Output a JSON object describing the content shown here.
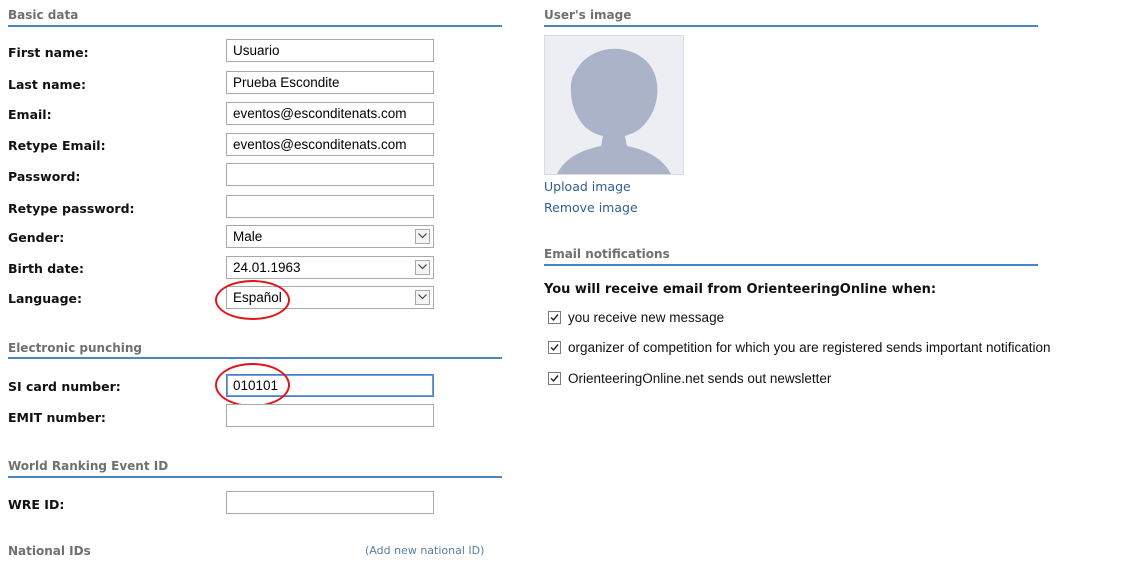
{
  "basic_data": {
    "title": "Basic data",
    "fields": [
      {
        "label": "First name:",
        "value": "Usuario",
        "type": "text"
      },
      {
        "label": "Last name:",
        "value": "Prueba Escondite",
        "type": "text"
      },
      {
        "label": "Email:",
        "value": "eventos@esconditenats.com",
        "type": "text"
      },
      {
        "label": "Retype Email:",
        "value": "eventos@esconditenats.com",
        "type": "text"
      },
      {
        "label": "Password:",
        "value": "",
        "type": "password"
      },
      {
        "label": "Retype password:",
        "value": "",
        "type": "password"
      },
      {
        "label": "Gender:",
        "value": "Male",
        "type": "select"
      },
      {
        "label": "Birth date:",
        "value": "24.01.1963",
        "type": "select"
      },
      {
        "label": "Language:",
        "value": "Español",
        "type": "select"
      }
    ]
  },
  "electronic_punching": {
    "title": "Electronic punching",
    "fields": [
      {
        "label": "SI card number:",
        "value": "010101"
      },
      {
        "label": "EMIT number:",
        "value": ""
      }
    ]
  },
  "world_ranking": {
    "title": "World Ranking Event ID",
    "fields": [
      {
        "label": "WRE ID:",
        "value": ""
      }
    ]
  },
  "national_ids": {
    "title": "National IDs",
    "add_link": "(Add new national ID)"
  },
  "user_image": {
    "title": "User's image",
    "upload_link": "Upload image",
    "remove_link": "Remove image"
  },
  "email_notifications": {
    "title": "Email notifications",
    "heading": "You will receive email from OrienteeringOnline when:",
    "options": [
      {
        "label": "you receive new message",
        "checked": true
      },
      {
        "label": "organizer of competition for which you are registered sends important notification",
        "checked": true
      },
      {
        "label": "OrienteeringOnline.net sends out newsletter",
        "checked": true
      }
    ]
  },
  "colors": {
    "section_rule": "#4a86c6",
    "link": "#2f5f8f",
    "highlight_circle": "#e0141a"
  }
}
